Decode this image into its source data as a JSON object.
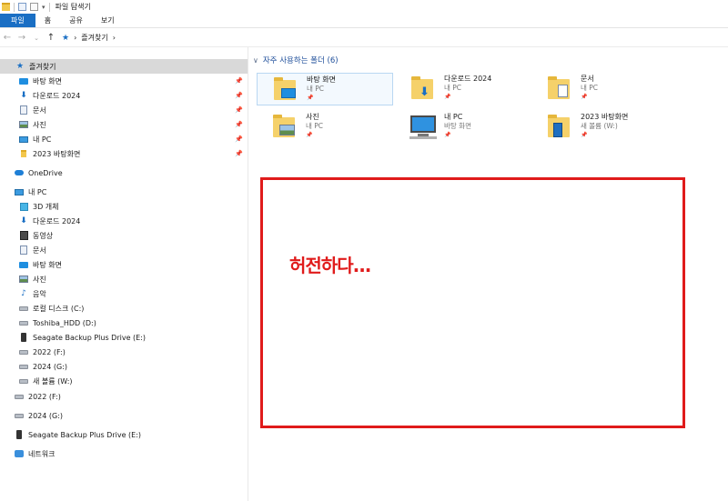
{
  "window": {
    "title": "파일 탐색기"
  },
  "ribbon": {
    "tabs": [
      "파일",
      "홈",
      "공유",
      "보기"
    ]
  },
  "address": {
    "crumb": "즐겨찾기"
  },
  "sidebar": {
    "quick_access": {
      "label": "즐겨찾기",
      "items": [
        {
          "label": "바탕 화면",
          "icon": "desktop-icon"
        },
        {
          "label": "다운로드 2024",
          "icon": "download-icon"
        },
        {
          "label": "문서",
          "icon": "documents-icon"
        },
        {
          "label": "사진",
          "icon": "pictures-icon"
        },
        {
          "label": "내 PC",
          "icon": "pc-icon"
        },
        {
          "label": "2023 바탕화면",
          "icon": "folder-icon"
        }
      ]
    },
    "onedrive": {
      "label": "OneDrive"
    },
    "this_pc": {
      "label": "내 PC",
      "items": [
        {
          "label": "3D 개체",
          "icon": "3d-objects-icon"
        },
        {
          "label": "다운로드 2024",
          "icon": "download-icon"
        },
        {
          "label": "동영상",
          "icon": "video-icon"
        },
        {
          "label": "문서",
          "icon": "documents-icon"
        },
        {
          "label": "바탕 화면",
          "icon": "desktop-icon"
        },
        {
          "label": "사진",
          "icon": "pictures-icon"
        },
        {
          "label": "음악",
          "icon": "music-icon"
        },
        {
          "label": "로컬 디스크 (C:)",
          "icon": "local-disk-icon"
        },
        {
          "label": "Toshiba_HDD (D:)",
          "icon": "drive-icon"
        },
        {
          "label": "Seagate Backup Plus Drive (E:)",
          "icon": "external-drive-icon"
        },
        {
          "label": "2022 (F:)",
          "icon": "drive-icon"
        },
        {
          "label": "2024 (G:)",
          "icon": "drive-icon"
        },
        {
          "label": "새 볼륨 (W:)",
          "icon": "drive-icon"
        }
      ]
    },
    "drives": [
      {
        "label": "2022 (F:)",
        "icon": "drive-icon"
      },
      {
        "label": "2024 (G:)",
        "icon": "drive-icon"
      },
      {
        "label": "Seagate Backup Plus Drive (E:)",
        "icon": "external-drive-icon"
      }
    ],
    "network": {
      "label": "네트워크"
    }
  },
  "main": {
    "section_title": "자주 사용하는 폴더 (6)",
    "folders": [
      {
        "name": "바탕 화면",
        "location": "내 PC"
      },
      {
        "name": "다운로드 2024",
        "location": "내 PC"
      },
      {
        "name": "문서",
        "location": "내 PC"
      },
      {
        "name": "사진",
        "location": "내 PC"
      },
      {
        "name": "내 PC",
        "location": "바탕 화면"
      },
      {
        "name": "2023 바탕화면",
        "location": "새 볼륨 (W:)"
      }
    ]
  },
  "annotation": {
    "text": "허전하다..."
  },
  "colors": {
    "accent": "#1a6fc4",
    "annotation_red": "#e01b1b",
    "selection": "#d9d9d9"
  }
}
